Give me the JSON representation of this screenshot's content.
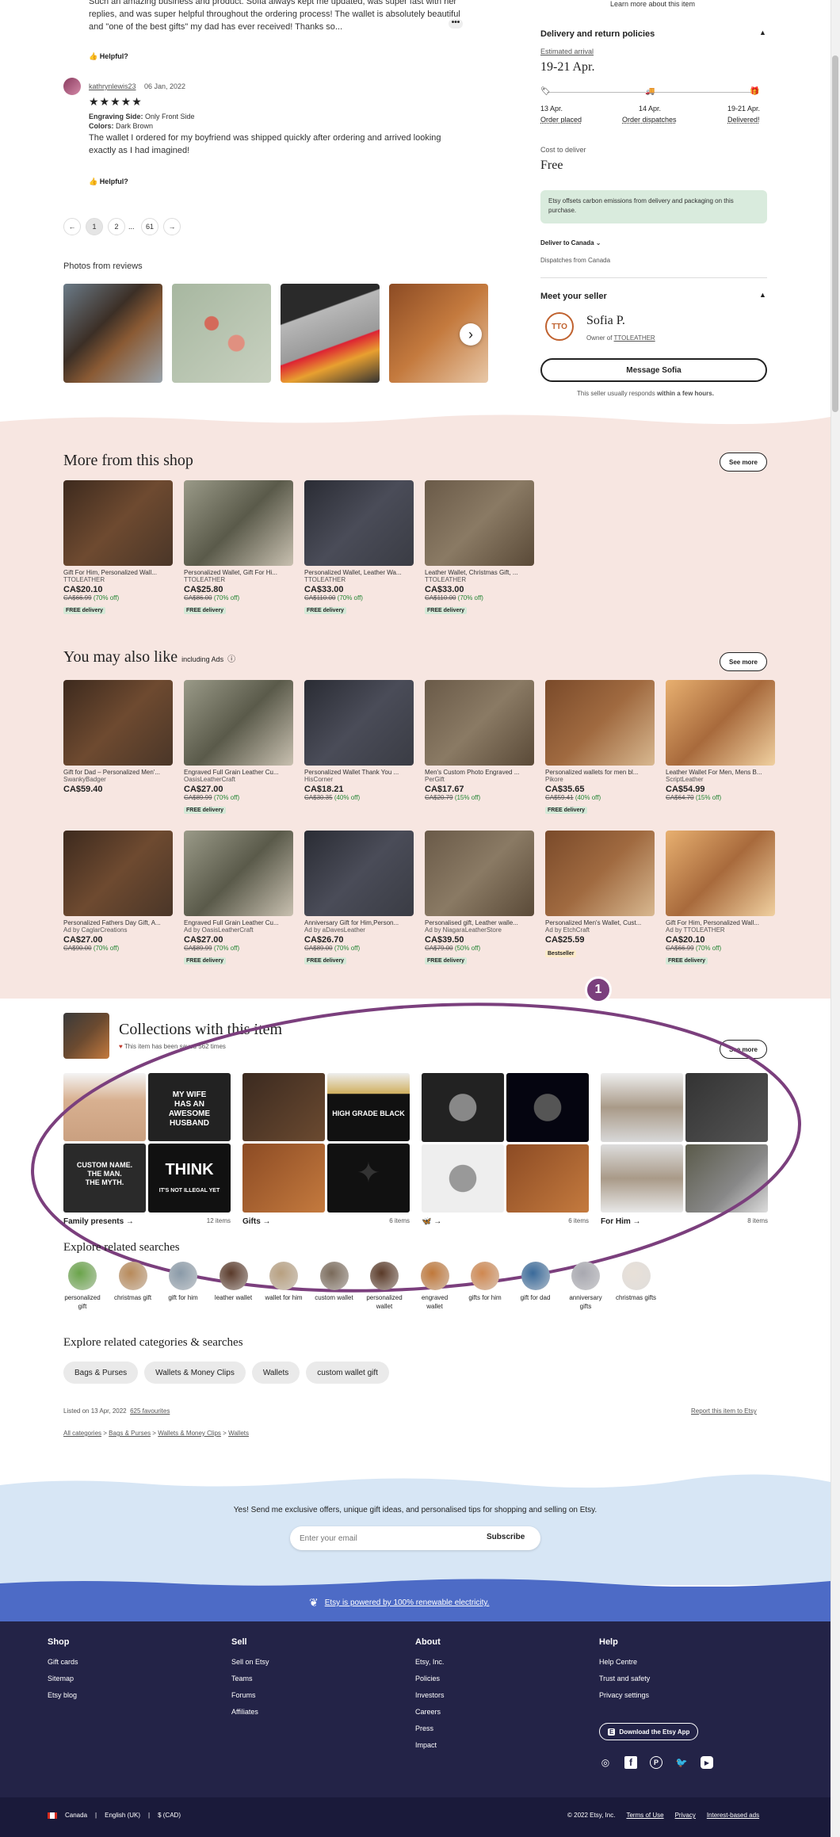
{
  "review_top": {
    "text": "Such an amazing business and product. Sofia always kept me updated, was super fast with her replies, and was super helpful throughout the ordering process! The wallet is absolutely beautiful and \"one of the best gifts\" my dad has ever received! Thanks so...",
    "helpful": "Helpful?"
  },
  "review2": {
    "user": "kathrynlewis23",
    "date": "06 Jan, 2022",
    "stars": "★★★★★",
    "engraving_label": "Engraving Side:",
    "engraving_value": "Only Front Side",
    "colors_label": "Colors:",
    "colors_value": "Dark Brown",
    "text": "The wallet I ordered for my boyfriend was shipped quickly after ordering and arrived looking exactly as I had imagined!",
    "helpful": "Helpful?"
  },
  "pagination": {
    "prev": "←",
    "p1": "1",
    "p2": "2",
    "dots": "...",
    "last": "61",
    "next": "→"
  },
  "photos": {
    "title": "Photos from reviews",
    "next": "›"
  },
  "sidebar": {
    "learn_more": "Learn more about this item",
    "delivery_title": "Delivery and return policies",
    "est_label": "Estimated arrival",
    "est_value": "19-21 Apr.",
    "steps": [
      {
        "date": "13 Apr.",
        "label": "Order placed"
      },
      {
        "date": "14 Apr.",
        "label": "Order dispatches"
      },
      {
        "date": "19-21 Apr.",
        "label": "Delivered!"
      }
    ],
    "cost_label": "Cost to deliver",
    "cost_value": "Free",
    "carbon": "Etsy offsets carbon emissions from delivery and packaging on this purchase.",
    "deliver_to": "Deliver to Canada",
    "dispatches": "Dispatches from Canada",
    "meet_seller": "Meet your seller",
    "seller_name": "Sofia P.",
    "owner_of": "Owner of",
    "shop": "TTOLEATHER",
    "message_btn": "Message Sofia",
    "responds": "This seller usually responds",
    "responds_bold": "within a few hours."
  },
  "more_shop": {
    "title": "More from this shop",
    "see_more": "See more",
    "items": [
      {
        "title": "Gift For Him, Personalized Wall...",
        "shop": "TTOLEATHER",
        "price": "CA$20.10",
        "old": "CA$66.99",
        "off": "(70% off)",
        "badge": "FREE delivery"
      },
      {
        "title": "Personalized Wallet, Gift For Hi...",
        "shop": "TTOLEATHER",
        "price": "CA$25.80",
        "old": "CA$86.00",
        "off": "(70% off)",
        "badge": "FREE delivery"
      },
      {
        "title": "Personalized Wallet, Leather Wa...",
        "shop": "TTOLEATHER",
        "price": "CA$33.00",
        "old": "CA$110.00",
        "off": "(70% off)",
        "badge": "FREE delivery"
      },
      {
        "title": "Leather Wallet, Christmas Gift, ...",
        "shop": "TTOLEATHER",
        "price": "CA$33.00",
        "old": "CA$110.00",
        "off": "(70% off)",
        "badge": "FREE delivery"
      }
    ]
  },
  "also_like": {
    "title": "You may also like",
    "ads": "including Ads",
    "see_more": "See more",
    "row1": [
      {
        "title": "Gift for Dad – Personalized Men'...",
        "shop": "SwankyBadger",
        "price": "CA$59.40",
        "old": "",
        "off": "",
        "badge": ""
      },
      {
        "title": "Engraved Full Grain Leather Cu...",
        "shop": "OasisLeatherCraft",
        "price": "CA$27.00",
        "old": "CA$89.99",
        "off": "(70% off)",
        "badge": "FREE delivery"
      },
      {
        "title": "Personalized Wallet Thank You ...",
        "shop": "HisCorner",
        "price": "CA$18.21",
        "old": "CA$30.35",
        "off": "(40% off)",
        "badge": ""
      },
      {
        "title": "Men's Custom Photo Engraved ...",
        "shop": "PerGift",
        "price": "CA$17.67",
        "old": "CA$20.79",
        "off": "(15% off)",
        "badge": ""
      },
      {
        "title": "Personalized wallets for men bl...",
        "shop": "Pikore",
        "price": "CA$35.65",
        "old": "CA$59.41",
        "off": "(40% off)",
        "badge": "FREE delivery"
      },
      {
        "title": "Leather Wallet For Men, Mens B...",
        "shop": "ScriptLeather",
        "price": "CA$54.99",
        "old": "CA$64.70",
        "off": "(15% off)",
        "badge": ""
      }
    ],
    "row2": [
      {
        "title": "Personalized Fathers Day Gift, A...",
        "shop": "Ad by CaglarCreations",
        "price": "CA$27.00",
        "old": "CA$90.00",
        "off": "(70% off)",
        "badge": ""
      },
      {
        "title": "Engraved Full Grain Leather Cu...",
        "shop": "Ad by OasisLeatherCraft",
        "price": "CA$27.00",
        "old": "CA$89.99",
        "off": "(70% off)",
        "badge": "FREE delivery"
      },
      {
        "title": "Anniversary Gift for Him,Person...",
        "shop": "Ad by aDavesLeather",
        "price": "CA$26.70",
        "old": "CA$89.00",
        "off": "(70% off)",
        "badge": "FREE delivery"
      },
      {
        "title": "Personalised gift, Leather walle...",
        "shop": "Ad by NiagaraLeatherStore",
        "price": "CA$39.50",
        "old": "CA$79.00",
        "off": "(50% off)",
        "badge": "FREE delivery"
      },
      {
        "title": "Personalized Men's Wallet, Cust...",
        "shop": "Ad by EtchCraft",
        "price": "CA$25.59",
        "old": "",
        "off": "",
        "badge": "Bestseller"
      },
      {
        "title": "Gift For Him, Personalized Wall...",
        "shop": "Ad by TTOLEATHER",
        "price": "CA$20.10",
        "old": "CA$66.99",
        "off": "(70% off)",
        "badge": "FREE delivery"
      }
    ]
  },
  "collections": {
    "title": "Collections with this item",
    "saved": "This item has been saved 562 times",
    "see_more": "See more",
    "marker": "1",
    "items": [
      {
        "name": "Family presents →",
        "count": "12 items"
      },
      {
        "name": "Gifts →",
        "count": "6 items"
      },
      {
        "name": "🦋 →",
        "count": "6 items"
      },
      {
        "name": "For Him →",
        "count": "8 items"
      }
    ]
  },
  "related_searches": {
    "title": "Explore related searches",
    "items": [
      "personalized gift",
      "christmas gift",
      "gift for him",
      "leather wallet",
      "wallet for him",
      "custom wallet",
      "personalized wallet",
      "engraved wallet",
      "gifts for him",
      "gift for dad",
      "anniversary gifts",
      "christmas gifts"
    ]
  },
  "related_categories": {
    "title": "Explore related categories & searches",
    "items": [
      "Bags & Purses",
      "Wallets & Money Clips",
      "Wallets",
      "custom wallet gift"
    ]
  },
  "listing": {
    "listed": "Listed on 13 Apr, 2022",
    "favs": "625 favourites",
    "report": "Report this item to Etsy",
    "crumbs": [
      "All categories",
      "Bags & Purses",
      "Wallets & Money Clips",
      "Wallets"
    ]
  },
  "newsletter": {
    "text": "Yes! Send me exclusive offers, unique gift ideas, and personalised tips for shopping and selling on Etsy.",
    "placeholder": "Enter your email",
    "button": "Subscribe"
  },
  "renewable": "Etsy is powered by 100% renewable electricity.",
  "footer": {
    "shop": {
      "title": "Shop",
      "links": [
        "Gift cards",
        "Sitemap",
        "Etsy blog"
      ]
    },
    "sell": {
      "title": "Sell",
      "links": [
        "Sell on Etsy",
        "Teams",
        "Forums",
        "Affiliates"
      ]
    },
    "about": {
      "title": "About",
      "links": [
        "Etsy, Inc.",
        "Policies",
        "Investors",
        "Careers",
        "Press",
        "Impact"
      ]
    },
    "help": {
      "title": "Help",
      "links": [
        "Help Centre",
        "Trust and safety",
        "Privacy settings"
      ]
    },
    "app_btn": "Download the Etsy App",
    "region": "Canada",
    "lang": "English (UK)",
    "currency": "$ (CAD)",
    "copyright": "© 2022 Etsy, Inc.",
    "legal": [
      "Terms of Use",
      "Privacy",
      "Interest-based ads"
    ]
  }
}
